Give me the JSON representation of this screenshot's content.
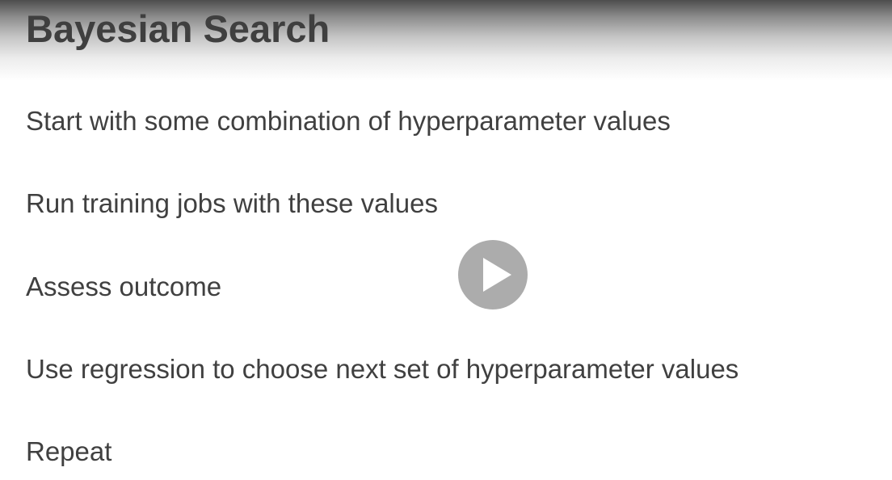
{
  "slide": {
    "title": "Bayesian Search",
    "bullets": [
      "Start with some combination of hyperparameter values",
      "Run training jobs with these values",
      "Assess outcome",
      "Use regression to choose next set of hyperparameter values",
      "Repeat"
    ]
  },
  "video_overlay": {
    "play_icon": "play-icon"
  }
}
